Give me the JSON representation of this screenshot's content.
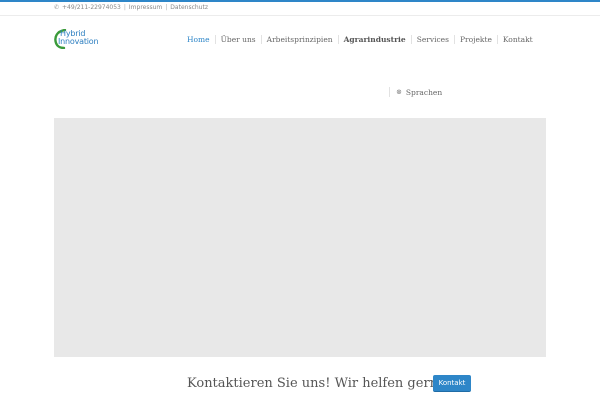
{
  "topbar": {
    "phone": "+49/211-22974053",
    "separator": "|",
    "impressum": "Impressum",
    "datenschutz": "Datenschutz"
  },
  "logo": {
    "line1": "Hybrid",
    "line2": "Innovation"
  },
  "nav": {
    "items": [
      {
        "label": "Home"
      },
      {
        "label": "Über uns"
      },
      {
        "label": "Arbeitsprinzipien"
      },
      {
        "label": "Agrarindustrie"
      },
      {
        "label": "Services"
      },
      {
        "label": "Projekte"
      },
      {
        "label": "Kontakt"
      }
    ]
  },
  "language": {
    "label": "Sprachen"
  },
  "cta": {
    "text": "Kontaktieren Sie uns! Wir helfen gerne",
    "button": "Kontakt"
  },
  "colors": {
    "accent": "#2e86c8",
    "hero_bg": "#e8e8e8",
    "logo_green": "#3a9a3a"
  },
  "icons": {
    "phone": "phone-icon",
    "language": "globe-icon"
  }
}
